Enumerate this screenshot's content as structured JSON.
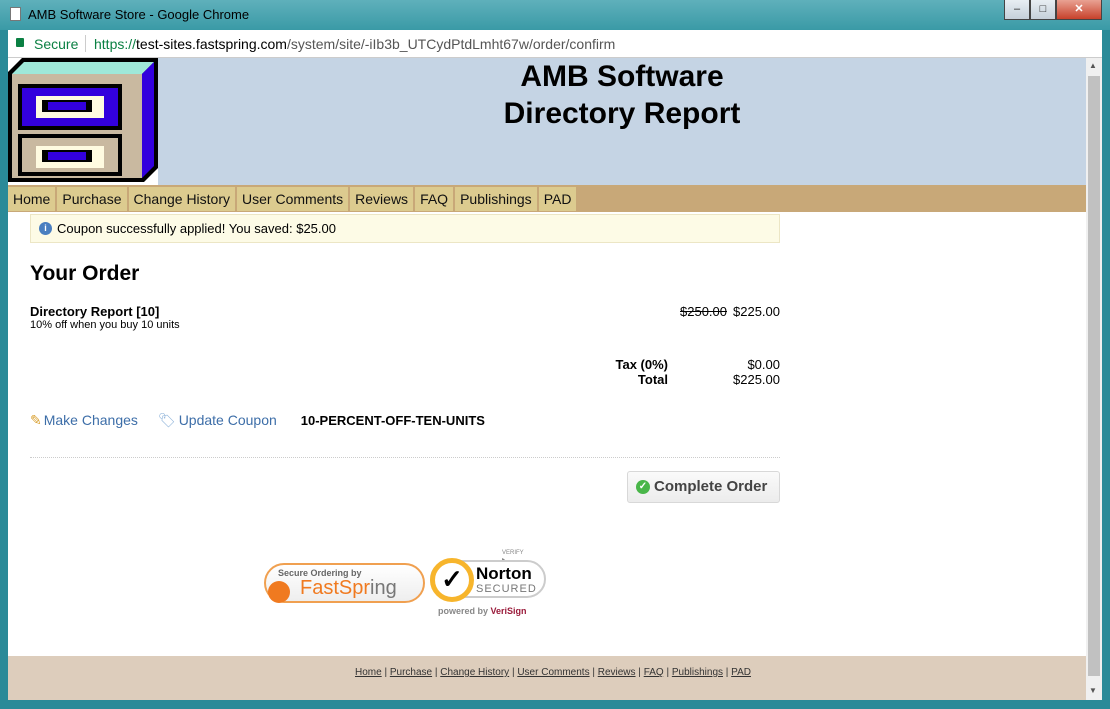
{
  "window": {
    "title": "AMB Software Store - Google Chrome",
    "minimize": "–",
    "maximize": "□",
    "close": "✕"
  },
  "address": {
    "secure_label": "Secure",
    "scheme": "https://",
    "host": "test-sites.fastspring.com",
    "path": "/system/site/-iIb3b_UTCydPtdLmht67w/order/confirm"
  },
  "header": {
    "title_line1": "AMB Software",
    "title_line2": "Directory Report"
  },
  "nav": [
    "Home",
    "Purchase",
    "Change History",
    "User Comments",
    "Reviews",
    "FAQ",
    "Publishings",
    "PAD"
  ],
  "notice": {
    "text": "Coupon successfully applied! You saved: $25.00"
  },
  "order": {
    "heading": "Your Order",
    "item_name": "Directory Report [10]",
    "item_note": "10% off when you buy 10 units",
    "original_price": "$250.00",
    "price": "$225.00",
    "tax_label": "Tax (0%)",
    "tax": "$0.00",
    "total_label": "Total",
    "total": "$225.00"
  },
  "actions": {
    "make_changes": "Make Changes",
    "update_coupon": "Update Coupon",
    "coupon_code": "10-PERCENT-OFF-TEN-UNITS",
    "complete": "Complete Order"
  },
  "badges": {
    "fs_top": "Secure Ordering by",
    "fs_brand1": "FastSpr",
    "fs_brand2": "ing",
    "norton_verify": "VERIFY ▸",
    "norton": "Norton",
    "norton_sub": "SECURED",
    "powered": "powered by",
    "verisign": "VeriSign"
  },
  "footer": [
    "Home",
    "Purchase",
    "Change History",
    "User Comments",
    "Reviews",
    "FAQ",
    "Publishings",
    "PAD"
  ],
  "colors": {
    "header_bg": "#c5d4e4",
    "nav_bg": "#c8a878",
    "nav_item": "#dccb8f",
    "footer_bg": "#ddcdbc",
    "link": "#3d6ea8"
  }
}
